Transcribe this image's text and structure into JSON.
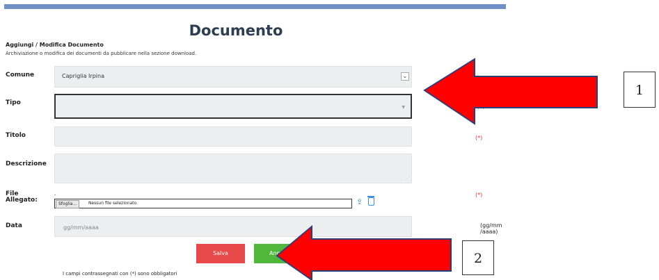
{
  "page": {
    "title": "Documento",
    "subtitle": "Aggiungi / Modifica Documento",
    "description": "Archiviazione o modifica dei documenti da pubblicare nella sezione download."
  },
  "form": {
    "comune": {
      "label": "Comune",
      "value": "Capriglia Irpina"
    },
    "tipo": {
      "label": "Tipo",
      "value": ""
    },
    "titolo": {
      "label": "Titolo",
      "value": ""
    },
    "descrizione": {
      "label": "Descrizione",
      "value": ""
    },
    "file": {
      "label_line1": "File",
      "label_line2": "Allegato:",
      "browse_label": "Sfoglia...",
      "status": "Nessun file selezionato."
    },
    "data": {
      "label": "Data",
      "placeholder": "gg/mm/aaaa",
      "format_hint": "(gg/mm /aaaa)"
    },
    "required_marker": "(*)",
    "required_note": "I campi contrassegnati con (*) sono obbligatori"
  },
  "buttons": {
    "save": "Salva",
    "cancel": "Annulla"
  },
  "annotations": {
    "label_1": "1",
    "label_2": "2"
  },
  "colors": {
    "header_bar": "#6f8fc5",
    "save": "#e84a4a",
    "cancel": "#4fb83a",
    "required": "#e03030",
    "arrow": "#ff0000"
  },
  "icons": {
    "upload": "upload-icon",
    "delete": "trash-icon",
    "dropdown": "chevron-down-icon"
  }
}
